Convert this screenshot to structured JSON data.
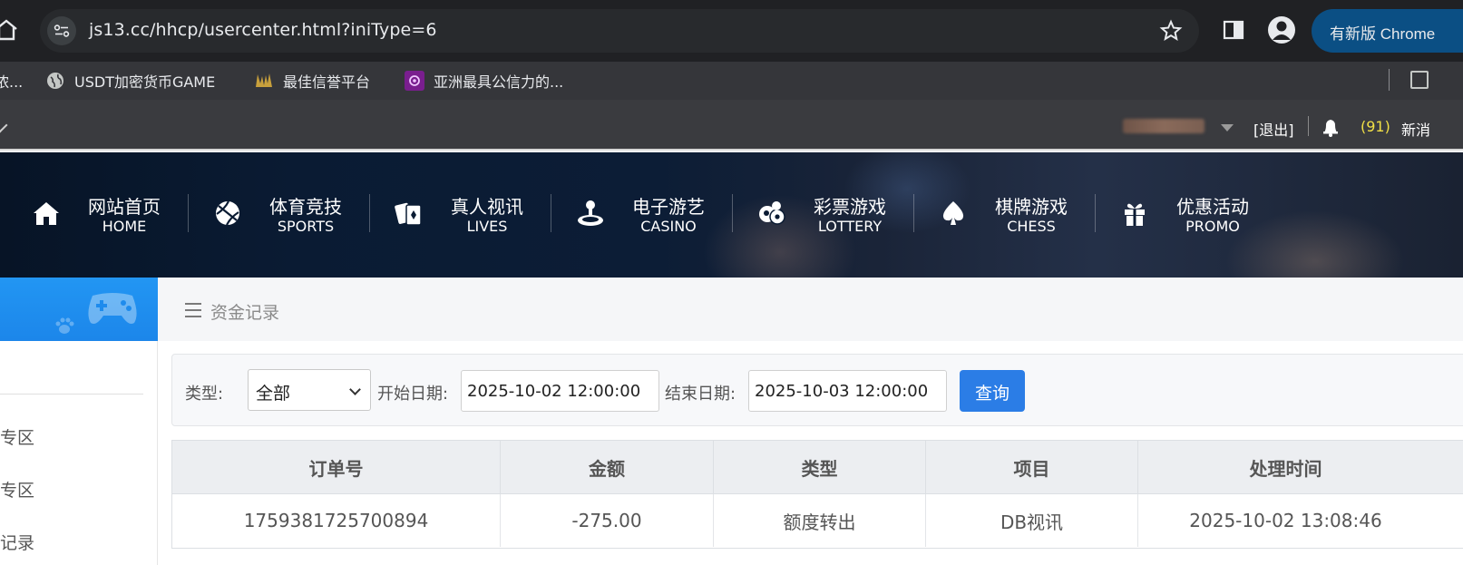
{
  "browser": {
    "url": "js13.cc/hhcp/usercenter.html?iniType=6",
    "update_label": "有新版 Chrome",
    "bookmarks": [
      {
        "label": "浓..."
      },
      {
        "label": "USDT加密货币GAME"
      },
      {
        "label": "最佳信誉平台"
      },
      {
        "label": "亚洲最具公信力的..."
      }
    ]
  },
  "site_top": {
    "logout": "[退出]",
    "message_count": "(91)",
    "message_label": "新消"
  },
  "nav": [
    {
      "cn": "网站首页",
      "en": "HOME",
      "icon": "home-icon"
    },
    {
      "cn": "体育竞技",
      "en": "SPORTS",
      "icon": "ball-icon"
    },
    {
      "cn": "真人视讯",
      "en": "LIVES",
      "icon": "cards-icon"
    },
    {
      "cn": "电子游艺",
      "en": "CASINO",
      "icon": "joystick-icon"
    },
    {
      "cn": "彩票游戏",
      "en": "LOTTERY",
      "icon": "lottery-balls-icon"
    },
    {
      "cn": "棋牌游戏",
      "en": "CHESS",
      "icon": "spade-icon"
    },
    {
      "cn": "优惠活动",
      "en": "PROMO",
      "icon": "gift-icon"
    }
  ],
  "sidebar": {
    "items": [
      {
        "label": "专区"
      },
      {
        "label": "专区"
      },
      {
        "label": "记录"
      }
    ]
  },
  "breadcrumb": {
    "title": "资金记录"
  },
  "filter": {
    "type_label": "类型:",
    "type_value": "全部",
    "start_label": "开始日期:",
    "start_value": "2025-10-02 12:00:00",
    "end_label": "结束日期:",
    "end_value": "2025-10-03 12:00:00",
    "query_label": "查询"
  },
  "table": {
    "headers": [
      "订单号",
      "金额",
      "类型",
      "项目",
      "处理时间"
    ],
    "rows": [
      [
        "1759381725700894",
        "-275.00",
        "额度转出",
        "DB视讯",
        "2025-10-02 13:08:46"
      ]
    ]
  },
  "colors": {
    "accent_blue": "#2b7de6",
    "sidebar_blue": "#2296f3",
    "message_yellow": "#f2e046"
  }
}
